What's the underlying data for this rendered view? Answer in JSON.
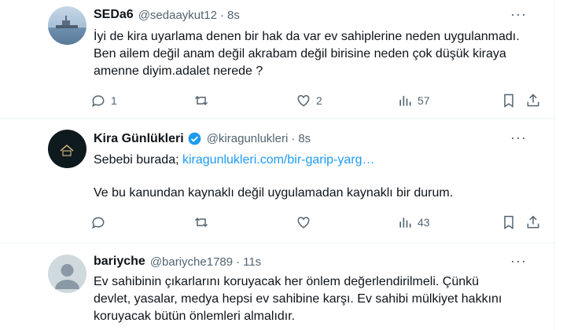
{
  "tweets": [
    {
      "name": "SEDa6",
      "handle": "@sedaaykut12",
      "separator": "·",
      "time": "8s",
      "more": "···",
      "lines": [
        "İyi de kira uyarlama denen bir hak da var ev sahiplerine neden uygulanmadı.",
        "Ben ailem değil anam değil akrabam değil birisine neden çok düşük kiraya",
        "amenne diyim.adalet nerede ?"
      ],
      "replies": "1",
      "likes": "2",
      "views": "57"
    },
    {
      "name": "Kira Günlükleri",
      "handle": "@kiragunlukleri",
      "separator": "·",
      "time": "8s",
      "more": "···",
      "line1_prefix": "Sebebi burada; ",
      "link": "kiragunlukleri.com/bir-garip-yarg…",
      "line2": "Ve bu kanundan kaynaklı değil uygulamadan kaynaklı bir durum.",
      "views": "43"
    },
    {
      "name": "bariyche",
      "handle": "@bariyche1789",
      "separator": "·",
      "time": "11s",
      "more": "···",
      "lines": [
        "Ev sahibinin çıkarlarını koruyacak her önlem değerlendirilmeli. Çünkü",
        "devlet, yasalar, medya hepsi ev sahibine karşı. Ev sahibi mülkiyet hakkını",
        "koruyacak bütün önlemleri almalıdır."
      ]
    }
  ],
  "colors": {
    "text": "#0f1419",
    "muted": "#536471",
    "link": "#1d9bf0",
    "verified": "#1d9bf0",
    "divider": "#eff3f4"
  },
  "icons": [
    "reply-icon",
    "retweet-icon",
    "like-icon",
    "views-icon",
    "bookmark-icon",
    "share-icon",
    "verified-badge-icon",
    "more-icon"
  ]
}
